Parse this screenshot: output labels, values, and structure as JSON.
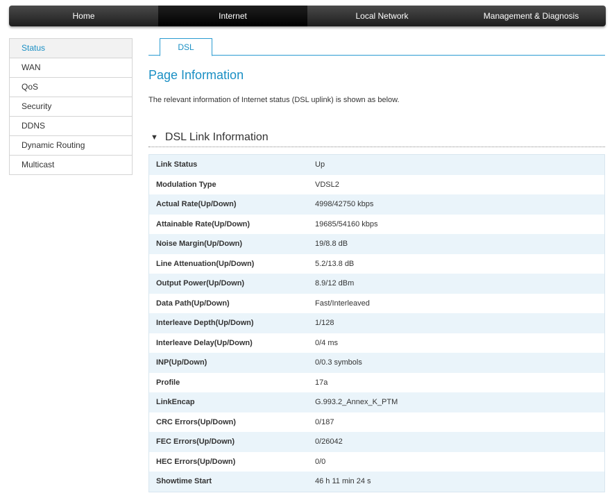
{
  "topnav": {
    "items": [
      {
        "label": "Home"
      },
      {
        "label": "Internet"
      },
      {
        "label": "Local Network"
      },
      {
        "label": "Management & Diagnosis"
      }
    ]
  },
  "sidebar": {
    "items": [
      {
        "label": "Status"
      },
      {
        "label": "WAN"
      },
      {
        "label": "QoS"
      },
      {
        "label": "Security"
      },
      {
        "label": "DDNS"
      },
      {
        "label": "Dynamic Routing"
      },
      {
        "label": "Multicast"
      }
    ]
  },
  "tabs": [
    {
      "label": "DSL"
    }
  ],
  "page": {
    "title": "Page Information",
    "description": "The relevant information of Internet status (DSL uplink) is shown as below."
  },
  "section": {
    "toggle_symbol": "▼",
    "title": "DSL Link Information"
  },
  "rows": [
    {
      "label": "Link Status",
      "value": "Up"
    },
    {
      "label": "Modulation Type",
      "value": "VDSL2"
    },
    {
      "label": "Actual Rate(Up/Down)",
      "value": "4998/42750 kbps"
    },
    {
      "label": "Attainable Rate(Up/Down)",
      "value": "19685/54160 kbps"
    },
    {
      "label": "Noise Margin(Up/Down)",
      "value": "19/8.8 dB"
    },
    {
      "label": "Line Attenuation(Up/Down)",
      "value": "5.2/13.8 dB"
    },
    {
      "label": "Output Power(Up/Down)",
      "value": "8.9/12 dBm"
    },
    {
      "label": "Data Path(Up/Down)",
      "value": "Fast/Interleaved"
    },
    {
      "label": "Interleave Depth(Up/Down)",
      "value": "1/128"
    },
    {
      "label": "Interleave Delay(Up/Down)",
      "value": "0/4 ms"
    },
    {
      "label": "INP(Up/Down)",
      "value": "0/0.3 symbols"
    },
    {
      "label": "Profile",
      "value": "17a"
    },
    {
      "label": "LinkEncap",
      "value": "G.993.2_Annex_K_PTM"
    },
    {
      "label": "CRC Errors(Up/Down)",
      "value": "0/187"
    },
    {
      "label": "FEC Errors(Up/Down)",
      "value": "0/26042"
    },
    {
      "label": "HEC Errors(Up/Down)",
      "value": "0/0"
    },
    {
      "label": "Showtime Start",
      "value": "46 h 11 min 24 s"
    }
  ],
  "colors": {
    "accent": "#1a8fc4",
    "nav_bg": "#2d2d2d",
    "row_alt": "#eaf4fa"
  }
}
